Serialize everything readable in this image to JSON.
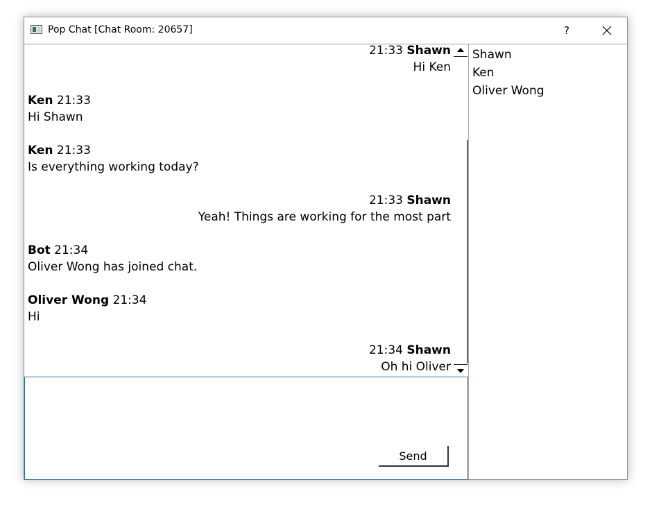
{
  "window": {
    "title": "Pop Chat [Chat Room: 20657]",
    "help_label": "?"
  },
  "messages": [
    {
      "sender": "Shawn",
      "time": "21:33",
      "text": "Hi Ken",
      "align": "right"
    },
    {
      "sender": "Ken",
      "time": "21:33",
      "text": "Hi Shawn",
      "align": "left"
    },
    {
      "sender": "Ken",
      "time": "21:33",
      "text": "Is everything working today?",
      "align": "left"
    },
    {
      "sender": "Shawn",
      "time": "21:33",
      "text": "Yeah! Things are working for the most part",
      "align": "right"
    },
    {
      "sender": "Bot",
      "time": "21:34",
      "text": "Oliver Wong has joined chat.",
      "align": "left"
    },
    {
      "sender": "Oliver Wong",
      "time": "21:34",
      "text": "Hi",
      "align": "left"
    },
    {
      "sender": "Shawn",
      "time": "21:34",
      "text": "Oh hi Oliver",
      "align": "right"
    }
  ],
  "users": [
    "Shawn",
    "Ken",
    "Oliver Wong"
  ],
  "compose": {
    "value": "",
    "send_label": "Send"
  }
}
